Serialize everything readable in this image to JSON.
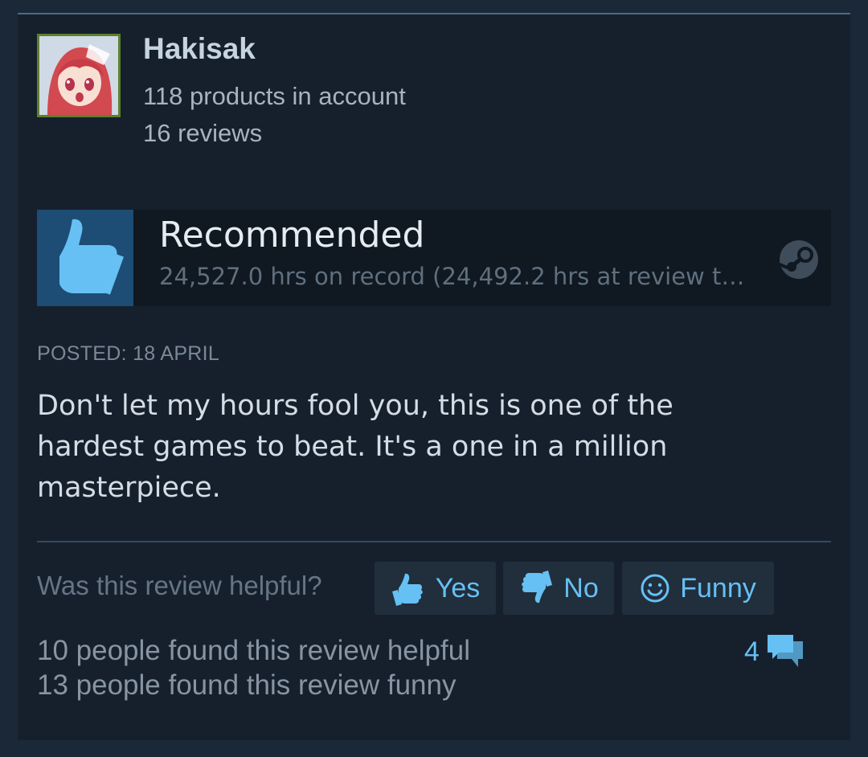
{
  "reviewer": {
    "name": "Hakisak",
    "products": "118 products in account",
    "reviews": "16 reviews"
  },
  "verdict": {
    "label": "Recommended",
    "hours": "24,527.0 hrs on record (24,492.2 hrs at review t…",
    "icon": "thumbs-up-icon"
  },
  "posted": "POSTED: 18 APRIL",
  "review_text": "Don't let my hours fool you, this is one of the hardest games to beat. It's a one in a million masterpiece.",
  "feedback": {
    "question": "Was this review helpful?",
    "yes_label": "Yes",
    "no_label": "No",
    "funny_label": "Funny"
  },
  "stats": {
    "helpful": "10 people found this review helpful",
    "funny": "13 people found this review funny",
    "comment_count": "4"
  },
  "colors": {
    "accent": "#66c0f4",
    "background": "#1b2838",
    "card": "#16202d"
  }
}
